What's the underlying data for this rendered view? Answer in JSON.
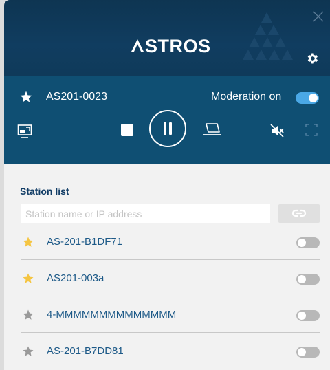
{
  "app": {
    "logo_text": "STROS"
  },
  "current": {
    "station": "AS201-0023",
    "moderation_label": "Moderation on"
  },
  "stations": {
    "title": "Station list",
    "search_placeholder": "Station name or IP address",
    "items": [
      {
        "name": "AS-201-B1DF71",
        "favorite": true,
        "enabled": false
      },
      {
        "name": "AS201-003a",
        "favorite": true,
        "enabled": false
      },
      {
        "name": "4-MMMMMMMMMMMMMM",
        "favorite": false,
        "enabled": false
      },
      {
        "name": "AS-201-B7DD81",
        "favorite": false,
        "enabled": false
      }
    ]
  },
  "colors": {
    "header_bg": "#0e3552",
    "panel_bg": "#0f4f73",
    "accent": "#4aa8e6",
    "star_favorite": "#f5c542",
    "star_default": "#9a9a9a",
    "station_text": "#1e5a88"
  }
}
